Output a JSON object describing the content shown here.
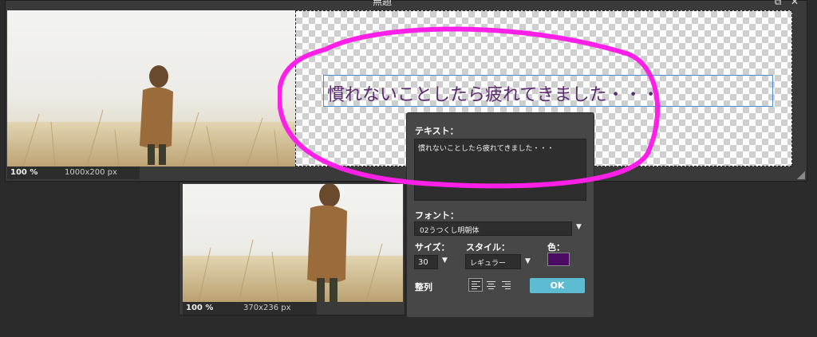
{
  "window": {
    "title": "無題",
    "controls": "⧉ ✕"
  },
  "canvas": {
    "zoom": "100  %",
    "size": "1000x200 px",
    "text_content": "慣れないことしたら疲れてきました・・・"
  },
  "preview": {
    "zoom": "100  %",
    "size": "370x236 px"
  },
  "dialog": {
    "text_label": "テキスト：",
    "text_value": "慣れないことしたら疲れてきました・・・",
    "font_label": "フォント：",
    "font_value": "02うつくし明朝体",
    "size_label": "サイズ：",
    "size_value": "30",
    "style_label": "スタイル：",
    "style_value": "レギュラー",
    "color_label": "色：",
    "align_label": "整列",
    "ok_label": "OK",
    "dropdown_arrow": "▼",
    "selected_alignment": "left"
  },
  "colors": {
    "text_color": "#5c2a6f",
    "swatch_color": "#4b0b62",
    "ok_button": "#5dbcd2",
    "annotation": "#ff20e8"
  },
  "icons": [
    "dropdown-arrow-icon",
    "align-left-icon",
    "align-center-icon",
    "align-right-icon",
    "resize-grip-icon",
    "restore-icon",
    "close-icon"
  ]
}
